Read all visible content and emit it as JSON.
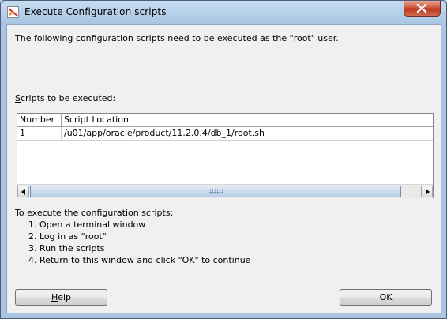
{
  "window": {
    "title": "Execute Configuration scripts"
  },
  "intro_text": "The following configuration scripts need to be executed as the \"root\" user.",
  "scripts_label": {
    "mnemonic": "S",
    "rest": "cripts to be executed:"
  },
  "table": {
    "columns": [
      "Number",
      "Script Location"
    ],
    "rows": [
      {
        "number": "1",
        "location": "/u01/app/oracle/product/11.2.0.4/db_1/root.sh"
      }
    ]
  },
  "instructions": {
    "heading": "To execute the configuration scripts:",
    "steps": [
      "1. Open a terminal window",
      "2. Log in as \"root\"",
      "3. Run the scripts",
      "4. Return to this window and click \"OK\" to continue"
    ]
  },
  "buttons": {
    "help": {
      "mnemonic": "H",
      "rest": "elp"
    },
    "ok": "OK"
  }
}
